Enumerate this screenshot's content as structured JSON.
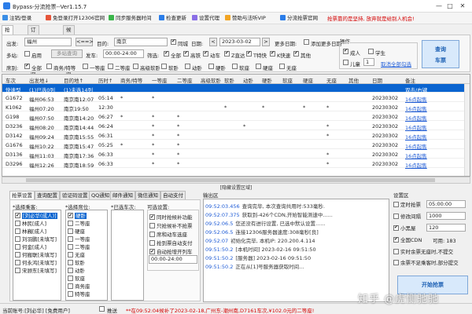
{
  "app": {
    "title": "Bypass-分流抢票--Ver1.15.7",
    "controls": [
      "—",
      "□",
      "✕"
    ]
  },
  "menubar": {
    "items": [
      "注销/登录",
      "免登录打开12306官网",
      "同步服务器时间",
      "检查更新",
      "设置代理",
      "赞助与法听VIP",
      "分流抢票官网"
    ],
    "icon_colors": [
      "#3a8ee6",
      "#e6553a",
      "#3ab54a",
      "#2b7de9",
      "#8a6ee6",
      "#f2a524",
      "#2b7de9"
    ],
    "notice": "抢票靠的是坚持, 放弃就是给别人机会!"
  },
  "tabs": [
    "抢票页面",
    "订单管理页面",
    "候补订票页面"
  ],
  "query": {
    "from_label": "出发:",
    "from_value": "福州",
    "swap_label": "<==>",
    "to_label": "目的:",
    "to_value": "南京",
    "same_city_label": "同城",
    "date_label": "日期:",
    "date_value": "2023-03-02",
    "more_date_label": "更多日期:",
    "add_more_date_label": "添加更多日期",
    "multi_station_label": "多站:",
    "enable_label": "启用",
    "multi_query_btn": "多站查询",
    "depart_label": "发车:",
    "depart_value": "00:00-24:00",
    "filter_label": "筛选:",
    "filters": [
      "全部",
      "高铁",
      "动车",
      "Z直达",
      "T特快",
      "K快速",
      "其他"
    ],
    "seat_label": "席别:",
    "seats": [
      "全部",
      "商务/特等",
      "一等座",
      "二等座",
      "高级软卧",
      "软卧",
      "动卧",
      "硬卧",
      "软座",
      "硬座",
      "无座"
    ],
    "ops_label": "操作",
    "adult_label": "成人",
    "student_label": "学生",
    "child_label": "儿童",
    "child_count": "1",
    "cancel_all_label": "取消全部勾选",
    "query_btn": "查询\n车票"
  },
  "grid": {
    "columns": [
      "车次",
      "出发地↓",
      "目的地↑",
      "历时↑",
      "商务/特等",
      "一等座",
      "二等座",
      "高级软卧",
      "软卧",
      "动卧",
      "硬卧",
      "软座",
      "硬座",
      "无座",
      "其他",
      "日期",
      "备注"
    ],
    "rows": [
      [
        "快速型",
        "(1)已选0列",
        "(1)未选14列",
        "",
        "",
        "",
        "",
        "",
        "",
        "",
        "",
        "",
        "",
        "",
        "",
        "",
        "双击/右键"
      ],
      [
        "G1672",
        "福州06:53",
        "南京南12:07",
        "05:14",
        "*",
        "*",
        "",
        "",
        "",
        "",
        "",
        "",
        "",
        "",
        "",
        "20230302",
        "16点起售"
      ],
      [
        "K1062",
        "福州07:20",
        "南京19:50",
        "12:30",
        "",
        "",
        "",
        "",
        "*",
        "",
        "*",
        "",
        "*",
        "*",
        "",
        "20230302",
        "16点起售"
      ],
      [
        "G198",
        "福州07:50",
        "南京南14:20",
        "06:27",
        "*",
        "*",
        "*",
        "",
        "",
        "",
        "",
        "",
        "",
        "",
        "",
        "20230302",
        "16点起售"
      ],
      [
        "D3236",
        "福州08:20",
        "南京南14:44",
        "06:24",
        "",
        "*",
        "*",
        "",
        "",
        "*",
        "",
        "",
        "",
        "*",
        "",
        "20230302",
        "16点起售"
      ],
      [
        "D3142",
        "福州09:24",
        "南京南15:55",
        "06:31",
        "",
        "*",
        "*",
        "",
        "",
        "",
        "",
        "",
        "",
        "*",
        "",
        "20230302",
        "16点起售"
      ],
      [
        "G1676",
        "福州10:22",
        "南京南15:47",
        "05:25",
        "*",
        "*",
        "*",
        "",
        "",
        "",
        "",
        "",
        "",
        "",
        "",
        "20230302",
        "16点起售"
      ],
      [
        "D3136",
        "福州11:03",
        "南京南17:36",
        "06:33",
        "",
        "*",
        "*",
        "",
        "",
        "",
        "",
        "",
        "",
        "*",
        "",
        "20230302",
        "16点起售"
      ],
      [
        "D3296",
        "福州12:26",
        "南京南18:59",
        "06:33",
        "",
        "*",
        "*",
        "",
        "",
        "",
        "",
        "",
        "",
        "*",
        "",
        "20230302",
        "16点起售"
      ]
    ]
  },
  "hide_area_label": "[隐藏设置区域]",
  "bottom_tabs": [
    "抢票设置",
    "查询配置",
    "验证码设置",
    "QQ通知",
    "邮件通知",
    "微信通知",
    "自动支付"
  ],
  "passengers": {
    "label": "*选择乘客:",
    "items": [
      {
        "name": "[刘必华(成人)]",
        "checked": true,
        "hl": true
      },
      {
        "name": "林民[成人]",
        "checked": false,
        "hl": false
      },
      {
        "name": "林巍[成人]",
        "checked": false,
        "hl": false
      },
      {
        "name": "刘羽鹏[未填写]",
        "checked": false,
        "hl": false
      },
      {
        "name": "何金[成人]",
        "checked": false,
        "hl": false
      },
      {
        "name": "何搬联[未填写]",
        "checked": false,
        "hl": false
      },
      {
        "name": "何永鸿[未填写]",
        "checked": false,
        "hl": false
      },
      {
        "name": "宋顾东[未填写]",
        "checked": false,
        "hl": false
      }
    ]
  },
  "seat_pick": {
    "label": "*选择席位:",
    "items": [
      {
        "name": "硬卧",
        "checked": true,
        "hl": true
      },
      {
        "name": "二等座",
        "checked": false,
        "hl": false
      },
      {
        "name": "硬座",
        "checked": false,
        "hl": false
      },
      {
        "name": "一等座",
        "checked": false,
        "hl": false
      },
      {
        "name": "二等座",
        "checked": false,
        "hl": false
      },
      {
        "name": "无座",
        "checked": false,
        "hl": false
      },
      {
        "name": "软卧",
        "checked": false,
        "hl": false
      },
      {
        "name": "动卧",
        "checked": false,
        "hl": false
      },
      {
        "name": "软座",
        "checked": false,
        "hl": false
      },
      {
        "name": "商务座",
        "checked": false,
        "hl": false
      },
      {
        "name": "特等座",
        "checked": false,
        "hl": false
      }
    ]
  },
  "train_pick": {
    "label": "*已选车次:"
  },
  "options": {
    "label": "可选设置:",
    "items": [
      {
        "name": "同时抢候补功能",
        "checked": true
      },
      {
        "name": "只抢候补不抢票",
        "checked": false
      },
      {
        "name": "席和动车选座",
        "checked": false
      },
      {
        "name": "抢到票自动支付",
        "checked": false
      },
      {
        "name": "自动抢增开列车",
        "checked": true
      }
    ],
    "time_value": "00:00-24:00"
  },
  "output": {
    "label": "输出区",
    "lines": [
      {
        "ts": "09:52:03.456",
        "msg": "查询完毕, 本次查询共用时:533毫秒."
      },
      {
        "ts": "09:52:07.375",
        "msg": "获取到-426个CDN,开始智能测速中......"
      },
      {
        "ts": "09:52:06.5",
        "msg": "您还没有进行设置, 已选中默认设置......"
      },
      {
        "ts": "09:52:06.5",
        "msg": "连接12306服务器速度:308毫秒[良]"
      },
      {
        "ts": "09:52:07",
        "msg": "初始化完毕, 本机IP: 220.200.4.114"
      },
      {
        "ts": "09:51:50.2",
        "msg": "[本机时间] 2023-02-16 09:51:50"
      },
      {
        "ts": "09:51:50.2",
        "msg": "[服务器] 2023-02-16 09:51:50"
      },
      {
        "ts": "09:51:50.2",
        "msg": "正在从[1]号服务器获取时间..."
      }
    ]
  },
  "settings": {
    "label": "设置区",
    "timed_label": "定时抢票",
    "timed_value": "05:00:00",
    "interval_label": "修改间隔",
    "interval_value": "1000",
    "black_label": "小黑屋",
    "black_value": "120",
    "cdn_label": "全国CDN",
    "cdn_value": "可用: 183",
    "real_submit_label": "实时余票无座时,不提交",
    "partial_submit_label": "余票不足乘客时,部分提交",
    "start_btn": "开始抢票"
  },
  "status": {
    "account": "当前账号:[刘必华] [免费用户]",
    "push_label": "推送",
    "news": "**在09:52:04候补了2023-02-18,广州东-潮州南,D7161车次,¥102.0元的二等座!"
  },
  "watermark": "知乎 @虎恻驰驰"
}
